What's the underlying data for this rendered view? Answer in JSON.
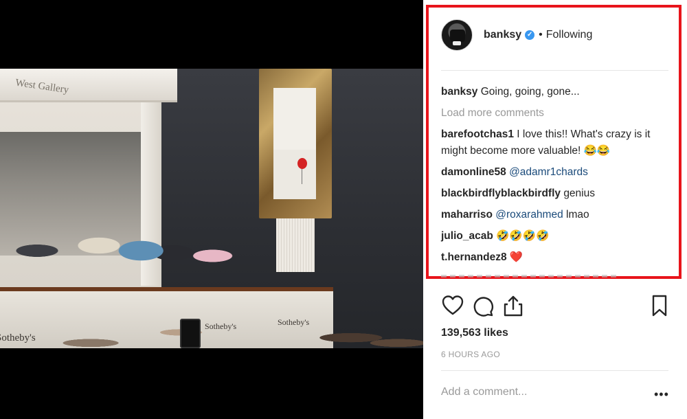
{
  "photo": {
    "gallery_sign": "West Gallery",
    "desk_brand": "Sotheby's"
  },
  "post": {
    "header": {
      "username": "banksy",
      "separator": "•",
      "follow_status": "Following"
    },
    "comments": [
      {
        "user": "banksy",
        "segments": [
          {
            "text": "Going, going, gone...",
            "kind": "text"
          }
        ]
      }
    ],
    "load_more": "Load more comments",
    "replies": [
      {
        "user": "barefootchas1",
        "segments": [
          {
            "text": "I love this!! What's crazy is it might become more valuable! 😂😂",
            "kind": "text"
          }
        ]
      },
      {
        "user": "damonline58",
        "segments": [
          {
            "text": "@adamr1chards",
            "kind": "mention"
          }
        ]
      },
      {
        "user": "blackbirdflyblackbirdfly",
        "segments": [
          {
            "text": "genius",
            "kind": "text"
          }
        ]
      },
      {
        "user": "maharriso",
        "segments": [
          {
            "text": "@roxarahmed",
            "kind": "mention"
          },
          {
            "text": "lmao",
            "kind": "text"
          }
        ]
      },
      {
        "user": "julio_acab",
        "segments": [
          {
            "text": "🤣🤣🤣🤣",
            "kind": "text"
          }
        ]
      },
      {
        "user": "t.hernandez8",
        "segments": [
          {
            "text": "❤️",
            "kind": "text"
          }
        ]
      }
    ],
    "likes": "139,563 likes",
    "timestamp": "6 HOURS AGO",
    "comment_placeholder": "Add a comment...",
    "more_glyph": "•••"
  },
  "colors": {
    "highlight_border": "#e8141b",
    "verified_blue": "#3897f0",
    "mention": "#1a4a7a",
    "muted": "#999999",
    "text": "#262626"
  },
  "icons": [
    "heart-icon",
    "comment-icon",
    "share-icon",
    "bookmark-icon",
    "verified-badge-icon",
    "more-options-icon"
  ]
}
